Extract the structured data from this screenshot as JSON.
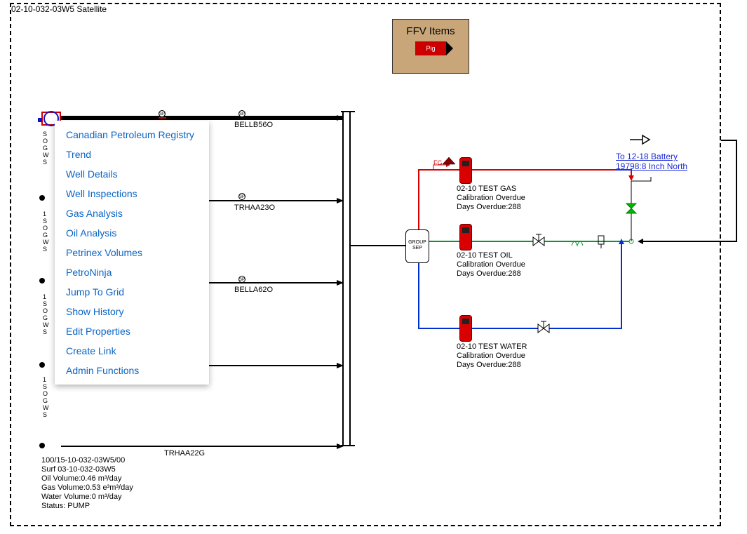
{
  "frame": {
    "title": "02-10-032-03W5 Satellite"
  },
  "ffv": {
    "title": "FFV Items",
    "pig": "Pig"
  },
  "menu": {
    "items": [
      "Canadian Petroleum Registry",
      "Trend",
      "Well Details",
      "Well Inspections",
      "Gas Analysis",
      "Oil Analysis",
      "Petrinex Volumes",
      "PetroNinja",
      "Jump To Grid",
      "Show History",
      "Edit Properties",
      "Create Link",
      "Admin Functions"
    ]
  },
  "sp_tag": "SP",
  "meters": {
    "m0": "BELLB56O",
    "m1": "TRHAA23O",
    "m2": "BELLA62O",
    "m3": "TRHAA22G"
  },
  "group_sep": "GROUP\nSEP",
  "fg_label": "FG",
  "devices": {
    "gas": {
      "line1": "02-10 TEST GAS",
      "line2": "Calibration Overdue",
      "line3": "Days Overdue:288"
    },
    "oil": {
      "line1": "02-10 TEST OIL",
      "line2": "Calibration Overdue",
      "line3": "Days Overdue:288"
    },
    "water": {
      "line1": "02-10 TEST WATER",
      "line2": "Calibration Overdue",
      "line3": "Days Overdue:288"
    }
  },
  "battery_link": {
    "line1": "To 12-18 Battery",
    "line2": "19798:8 Inch North"
  },
  "well_info": {
    "l1": "100/15-10-032-03W5/00",
    "l2": "Surf 03-10-032-03W5",
    "l3": "Oil Volume:0.46 m³/day",
    "l4": "Gas Volume:0.53 e³m³/day",
    "l5": "Water Volume:0 m³/day",
    "l6": "Status: PUMP"
  },
  "left_tags": {
    "t0": "S\nO\nG\nW\nS",
    "t1": "1\nS\nO\nG\nW\nS",
    "t2": "1\nS\nO\nG\nW\nS",
    "t3": "1\nS\nO\nG\nW\nS"
  }
}
